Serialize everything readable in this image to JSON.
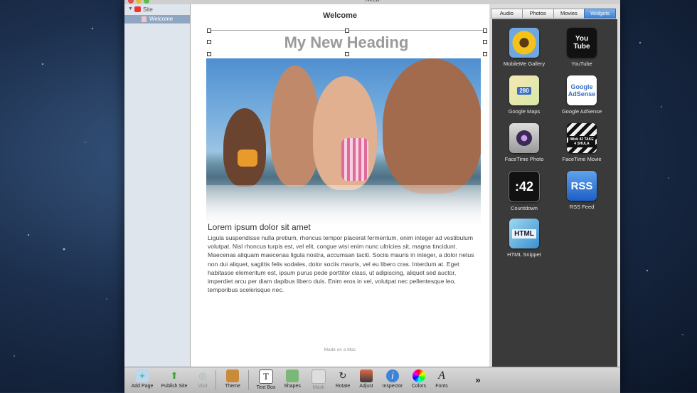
{
  "app": {
    "window_title": "iWeb"
  },
  "sidebar": {
    "site_label": "Site",
    "page_label": "Welcome"
  },
  "canvas": {
    "page_title": "Welcome",
    "heading": "My New Heading",
    "lorem_title": "Lorem ipsum dolor sit amet",
    "lorem_body": "Ligula suspendisse nulla pretium, rhoncus tempor placerat fermentum, enim integer ad vestibulum volutpat. Nisl rhoncus turpis est, vel elit, congue wisi enim nunc ultricies sit, magna tincidunt. Maecenas aliquam maecenas ligula nostra, accumsan taciti. Sociis mauris in integer, a dolor netus non dui aliquet, sagittis felis sodales, dolor sociis mauris, vel eu libero cras. Interdum at. Eget habitasse elementum est, ipsum purus pede porttitor class, ut adipiscing, aliquet sed auctor, imperdiet arcu per diam dapibus libero duis. Enim eros in vel, volutpat nec pellentesque leo, temporibus scelerisque nec.",
    "made_on": "Made on a Mac"
  },
  "media": {
    "tabs": [
      {
        "label": "Audio",
        "active": false
      },
      {
        "label": "Photos",
        "active": false
      },
      {
        "label": "Movies",
        "active": false
      },
      {
        "label": "Widgets",
        "active": true
      }
    ],
    "widgets": [
      {
        "label": "MobileMe Gallery",
        "icon": "sunflower-icon"
      },
      {
        "label": "YouTube",
        "icon": "youtube-icon",
        "icon_text": "You Tube"
      },
      {
        "label": "Google Maps",
        "icon": "google-maps-icon",
        "icon_text": "280"
      },
      {
        "label": "Google AdSense",
        "icon": "google-adsense-icon",
        "icon_text": "Google AdSense"
      },
      {
        "label": "FaceTime Photo",
        "icon": "facetime-photo-icon"
      },
      {
        "label": "FaceTime Movie",
        "icon": "clapperboard-icon",
        "icon_text": "iWeb 42 TAKE 4 SHULA"
      },
      {
        "label": "Countdown",
        "icon": "countdown-icon",
        "icon_text": ":42"
      },
      {
        "label": "RSS Feed",
        "icon": "rss-icon",
        "icon_text": "RSS"
      },
      {
        "label": "HTML Snippet",
        "icon": "html-icon",
        "icon_text": "HTML"
      }
    ]
  },
  "toolbar": {
    "add_page": "Add Page",
    "publish_site": "Publish Site",
    "visit": "Visit",
    "theme": "Theme",
    "text_box": "Text Box",
    "shapes": "Shapes",
    "mask": "Mask",
    "rotate": "Rotate",
    "adjust": "Adjust",
    "inspector": "Inspector",
    "colors": "Colors",
    "fonts": "Fonts",
    "overflow": "»"
  },
  "colors": {
    "accent": "#3d83d7",
    "desktop": "#1c2f4d"
  }
}
